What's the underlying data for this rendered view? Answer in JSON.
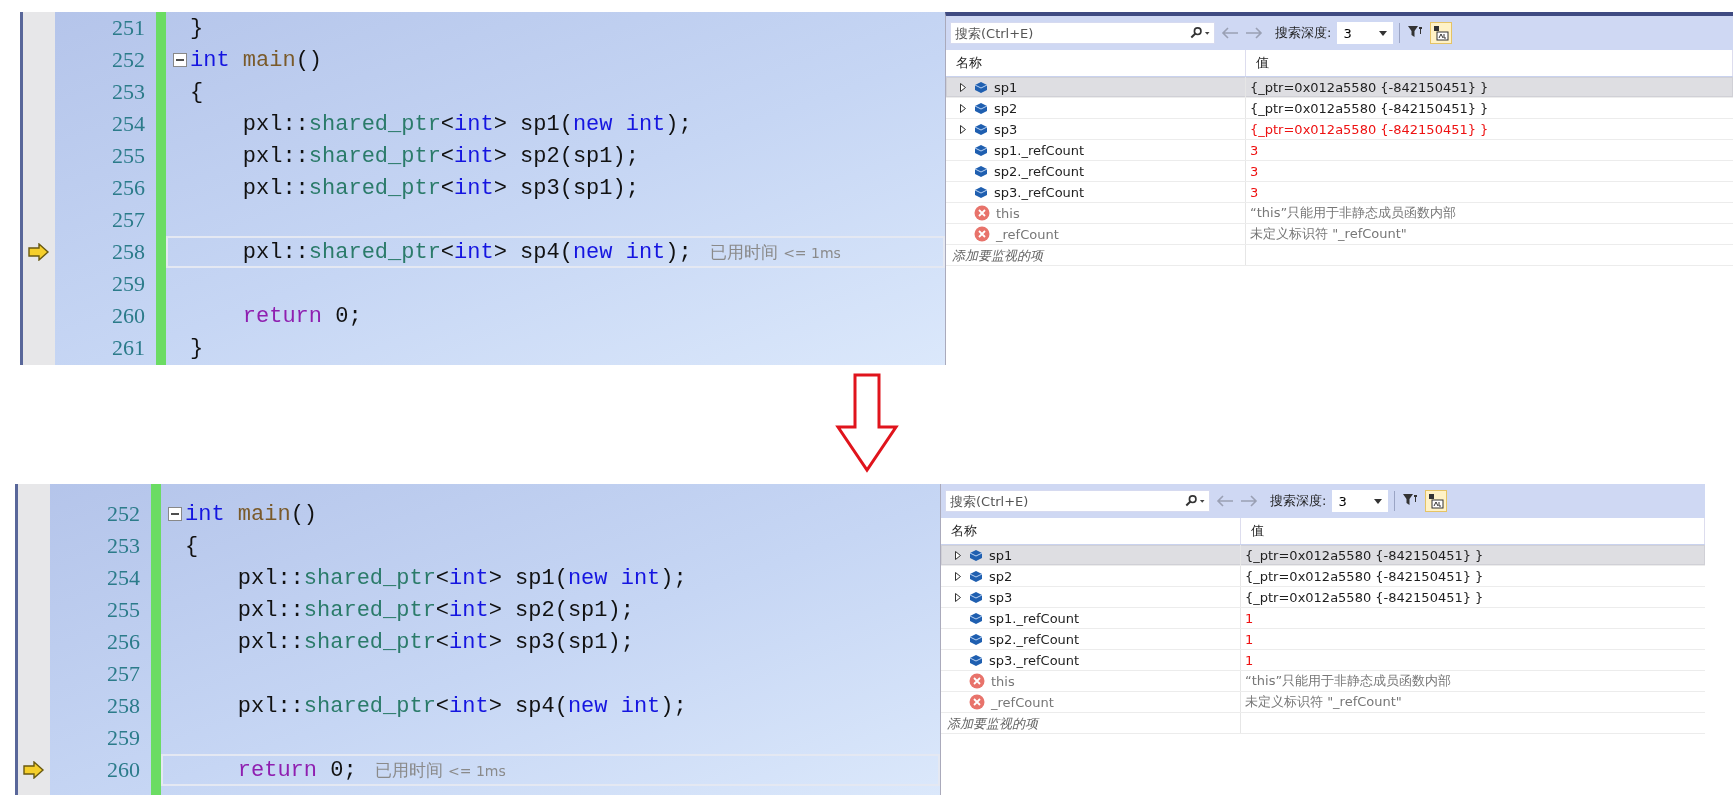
{
  "panels": [
    {
      "editor": {
        "lines": [
          {
            "number": "251",
            "fold": false,
            "current": false,
            "tokens": [
              {
                "kind": "plain",
                "text": "}"
              }
            ]
          },
          {
            "number": "252",
            "fold": true,
            "current": false,
            "tokens": [
              {
                "kind": "keyword",
                "text": "int "
              },
              {
                "kind": "function",
                "text": "main"
              },
              {
                "kind": "plain",
                "text": "()"
              }
            ]
          },
          {
            "number": "253",
            "fold": false,
            "current": false,
            "tokens": [
              {
                "kind": "plain",
                "text": "{"
              }
            ]
          },
          {
            "number": "254",
            "fold": false,
            "current": false,
            "tokens": [
              {
                "kind": "plain",
                "text": "    pxl::"
              },
              {
                "kind": "type",
                "text": "shared_ptr"
              },
              {
                "kind": "plain",
                "text": "<"
              },
              {
                "kind": "keyword",
                "text": "int"
              },
              {
                "kind": "plain",
                "text": "> sp1("
              },
              {
                "kind": "keyword",
                "text": "new int"
              },
              {
                "kind": "plain",
                "text": ");"
              }
            ]
          },
          {
            "number": "255",
            "fold": false,
            "current": false,
            "tokens": [
              {
                "kind": "plain",
                "text": "    pxl::"
              },
              {
                "kind": "type",
                "text": "shared_ptr"
              },
              {
                "kind": "plain",
                "text": "<"
              },
              {
                "kind": "keyword",
                "text": "int"
              },
              {
                "kind": "plain",
                "text": "> sp2(sp1);"
              }
            ]
          },
          {
            "number": "256",
            "fold": false,
            "current": false,
            "tokens": [
              {
                "kind": "plain",
                "text": "    pxl::"
              },
              {
                "kind": "type",
                "text": "shared_ptr"
              },
              {
                "kind": "plain",
                "text": "<"
              },
              {
                "kind": "keyword",
                "text": "int"
              },
              {
                "kind": "plain",
                "text": "> sp3(sp1);"
              }
            ]
          },
          {
            "number": "257",
            "fold": false,
            "current": false
          },
          {
            "number": "258",
            "fold": false,
            "current": true,
            "hint": {
              "label": "已用时间",
              "value": "<= 1ms"
            },
            "tokens": [
              {
                "kind": "plain",
                "text": "    pxl::"
              },
              {
                "kind": "type",
                "text": "shared_ptr"
              },
              {
                "kind": "plain",
                "text": "<"
              },
              {
                "kind": "keyword",
                "text": "int"
              },
              {
                "kind": "plain",
                "text": "> sp4("
              },
              {
                "kind": "keyword",
                "text": "new int"
              },
              {
                "kind": "plain",
                "text": ");"
              }
            ]
          },
          {
            "number": "259",
            "fold": false,
            "current": false
          },
          {
            "number": "260",
            "fold": false,
            "current": false,
            "tokens": [
              {
                "kind": "control",
                "text": "    return"
              },
              {
                "kind": "plain",
                "text": " 0;"
              }
            ]
          },
          {
            "number": "261",
            "fold": false,
            "current": false,
            "tokens": [
              {
                "kind": "plain",
                "text": "}"
              }
            ]
          }
        ]
      },
      "watch": {
        "search": {
          "placeholder": "搜索(Ctrl+E)"
        },
        "depth_label": "搜索深度:",
        "depth": "3",
        "raw_format_on": true,
        "columns": [
          "名称",
          "值"
        ],
        "rows": [
          {
            "kind": "variable",
            "name": "sp1",
            "value": "{_ptr=0x012a5580 {-842150451} }",
            "expandable": true,
            "changed": false,
            "selected": true
          },
          {
            "kind": "variable",
            "name": "sp2",
            "value": "{_ptr=0x012a5580 {-842150451} }",
            "expandable": true,
            "changed": false,
            "selected": false
          },
          {
            "kind": "variable",
            "name": "sp3",
            "value": "{_ptr=0x012a5580 {-842150451} }",
            "expandable": true,
            "changed": true,
            "selected": false
          },
          {
            "kind": "variable",
            "name": "sp1._refCount",
            "value": "3",
            "expandable": false,
            "changed": true,
            "selected": false
          },
          {
            "kind": "variable",
            "name": "sp2._refCount",
            "value": "3",
            "expandable": false,
            "changed": true,
            "selected": false
          },
          {
            "kind": "variable",
            "name": "sp3._refCount",
            "value": "3",
            "expandable": false,
            "changed": true,
            "selected": false
          },
          {
            "kind": "error",
            "name": "this",
            "value": "“this”只能用于非静态成员函数内部",
            "expandable": false,
            "changed": false,
            "selected": false
          },
          {
            "kind": "error",
            "name": "_refCount",
            "value": "未定义标识符 \"_refCount\"",
            "expandable": false,
            "changed": false,
            "selected": false
          }
        ],
        "add_placeholder": "添加要监视的项"
      }
    },
    {
      "editor": {
        "lines": [
          {
            "number": "252",
            "fold": true,
            "current": false,
            "tokens": [
              {
                "kind": "keyword",
                "text": "int "
              },
              {
                "kind": "function",
                "text": "main"
              },
              {
                "kind": "plain",
                "text": "()"
              }
            ]
          },
          {
            "number": "253",
            "fold": false,
            "current": false,
            "tokens": [
              {
                "kind": "plain",
                "text": "{"
              }
            ]
          },
          {
            "number": "254",
            "fold": false,
            "current": false,
            "tokens": [
              {
                "kind": "plain",
                "text": "    pxl::"
              },
              {
                "kind": "type",
                "text": "shared_ptr"
              },
              {
                "kind": "plain",
                "text": "<"
              },
              {
                "kind": "keyword",
                "text": "int"
              },
              {
                "kind": "plain",
                "text": "> sp1("
              },
              {
                "kind": "keyword",
                "text": "new int"
              },
              {
                "kind": "plain",
                "text": ");"
              }
            ]
          },
          {
            "number": "255",
            "fold": false,
            "current": false,
            "tokens": [
              {
                "kind": "plain",
                "text": "    pxl::"
              },
              {
                "kind": "type",
                "text": "shared_ptr"
              },
              {
                "kind": "plain",
                "text": "<"
              },
              {
                "kind": "keyword",
                "text": "int"
              },
              {
                "kind": "plain",
                "text": "> sp2(sp1);"
              }
            ]
          },
          {
            "number": "256",
            "fold": false,
            "current": false,
            "tokens": [
              {
                "kind": "plain",
                "text": "    pxl::"
              },
              {
                "kind": "type",
                "text": "shared_ptr"
              },
              {
                "kind": "plain",
                "text": "<"
              },
              {
                "kind": "keyword",
                "text": "int"
              },
              {
                "kind": "plain",
                "text": "> sp3(sp1);"
              }
            ]
          },
          {
            "number": "257",
            "fold": false,
            "current": false
          },
          {
            "number": "258",
            "fold": false,
            "current": false,
            "tokens": [
              {
                "kind": "plain",
                "text": "    pxl::"
              },
              {
                "kind": "type",
                "text": "shared_ptr"
              },
              {
                "kind": "plain",
                "text": "<"
              },
              {
                "kind": "keyword",
                "text": "int"
              },
              {
                "kind": "plain",
                "text": "> sp4("
              },
              {
                "kind": "keyword",
                "text": "new int"
              },
              {
                "kind": "plain",
                "text": ");"
              }
            ]
          },
          {
            "number": "259",
            "fold": false,
            "current": false
          },
          {
            "number": "260",
            "fold": false,
            "current": true,
            "hint": {
              "label": "已用时间",
              "value": "<= 1ms"
            },
            "tokens": [
              {
                "kind": "control",
                "text": "    return"
              },
              {
                "kind": "plain",
                "text": " 0;"
              }
            ]
          }
        ]
      },
      "watch": {
        "search": {
          "placeholder": "搜索(Ctrl+E)"
        },
        "depth_label": "搜索深度:",
        "depth": "3",
        "raw_format_on": true,
        "columns": [
          "名称",
          "值"
        ],
        "rows": [
          {
            "kind": "variable",
            "name": "sp1",
            "value": "{_ptr=0x012a5580 {-842150451} }",
            "expandable": true,
            "changed": false,
            "selected": true
          },
          {
            "kind": "variable",
            "name": "sp2",
            "value": "{_ptr=0x012a5580 {-842150451} }",
            "expandable": true,
            "changed": false,
            "selected": false
          },
          {
            "kind": "variable",
            "name": "sp3",
            "value": "{_ptr=0x012a5580 {-842150451} }",
            "expandable": true,
            "changed": false,
            "selected": false
          },
          {
            "kind": "variable",
            "name": "sp1._refCount",
            "value": "1",
            "expandable": false,
            "changed": true,
            "selected": false
          },
          {
            "kind": "variable",
            "name": "sp2._refCount",
            "value": "1",
            "expandable": false,
            "changed": true,
            "selected": false
          },
          {
            "kind": "variable",
            "name": "sp3._refCount",
            "value": "1",
            "expandable": false,
            "changed": true,
            "selected": false
          },
          {
            "kind": "error",
            "name": "this",
            "value": "“this”只能用于非静态成员函数内部",
            "expandable": false,
            "changed": false,
            "selected": false
          },
          {
            "kind": "error",
            "name": "_refCount",
            "value": "未定义标识符 \"_refCount\"",
            "expandable": false,
            "changed": false,
            "selected": false
          }
        ],
        "add_placeholder": "添加要监视的项"
      }
    }
  ]
}
